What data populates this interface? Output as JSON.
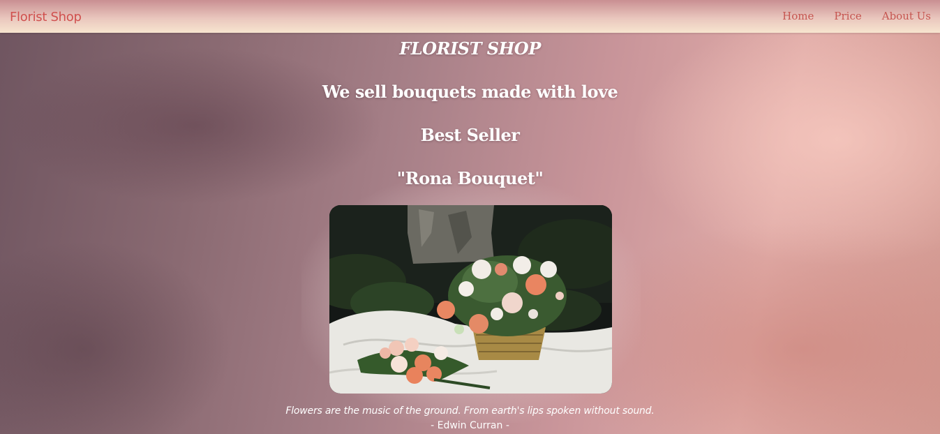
{
  "nav": {
    "brand": "Florist Shop",
    "links": [
      {
        "label": "Home"
      },
      {
        "label": "Price"
      },
      {
        "label": "About Us"
      }
    ]
  },
  "hero": {
    "title": "FLORIST SHOP",
    "tagline": "We sell bouquets made with love",
    "best_seller_label": "Best Seller",
    "product_name": "\"Rona Bouquet\""
  },
  "quote": {
    "text": "Flowers are the music of the ground. From earth's lips spoken without sound.",
    "author": "- Edwin Curran -"
  },
  "colors": {
    "brand": "#d0504e",
    "nav_link": "#c65550",
    "hero_text": "#ffffff"
  }
}
